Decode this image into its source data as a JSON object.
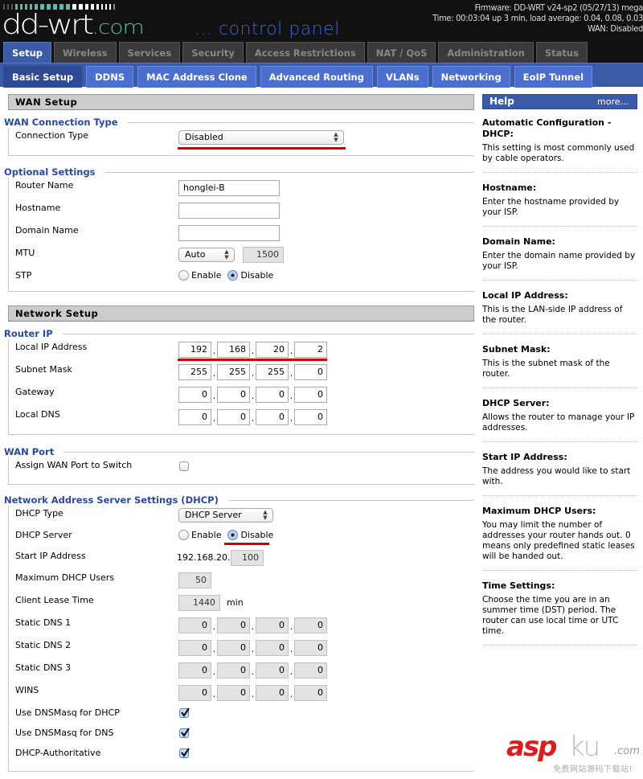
{
  "header": {
    "logo_main": "dd-wrt",
    "logo_suffix": ".com",
    "tagline": "... control panel",
    "firmware": "Firmware: DD-WRT v24-sp2 (05/27/13) mega",
    "time": "Time: 00:03:04 up 3 min, load average: 0.04, 0.08, 0.03",
    "wan_status": "WAN: Disabled",
    "colors": {
      "accent": "#3b5ba6",
      "logo_teal": "#5fb8a8",
      "tagline_blue": "#3a66d6"
    }
  },
  "main_tabs": [
    {
      "label": "Setup",
      "active": true
    },
    {
      "label": "Wireless",
      "active": false
    },
    {
      "label": "Services",
      "active": false
    },
    {
      "label": "Security",
      "active": false
    },
    {
      "label": "Access Restrictions",
      "active": false
    },
    {
      "label": "NAT / QoS",
      "active": false
    },
    {
      "label": "Administration",
      "active": false
    },
    {
      "label": "Status",
      "active": false
    }
  ],
  "sub_tabs": [
    {
      "label": "Basic Setup",
      "active": true
    },
    {
      "label": "DDNS",
      "active": false
    },
    {
      "label": "MAC Address Clone",
      "active": false
    },
    {
      "label": "Advanced Routing",
      "active": false
    },
    {
      "label": "VLANs",
      "active": false
    },
    {
      "label": "Networking",
      "active": false
    },
    {
      "label": "EoIP Tunnel",
      "active": false
    }
  ],
  "wan_setup": {
    "title": "WAN Setup",
    "connection": {
      "legend": "WAN Connection Type",
      "label": "Connection Type",
      "value": "Disabled"
    },
    "optional": {
      "legend": "Optional Settings",
      "router_name": {
        "label": "Router Name",
        "value": "honglei-B"
      },
      "hostname": {
        "label": "Hostname",
        "value": ""
      },
      "domain_name": {
        "label": "Domain Name",
        "value": ""
      },
      "mtu": {
        "label": "MTU",
        "mode": "Auto",
        "value": "1500"
      },
      "stp": {
        "label": "STP",
        "enable": "Enable",
        "disable": "Disable",
        "selected": "Disable"
      }
    }
  },
  "network_setup": {
    "title": "Network Setup",
    "router_ip": {
      "legend": "Router IP",
      "local_ip": {
        "label": "Local IP Address",
        "octets": [
          "192",
          "168",
          "20",
          "2"
        ]
      },
      "subnet": {
        "label": "Subnet Mask",
        "octets": [
          "255",
          "255",
          "255",
          "0"
        ]
      },
      "gateway": {
        "label": "Gateway",
        "octets": [
          "0",
          "0",
          "0",
          "0"
        ]
      },
      "local_dns": {
        "label": "Local DNS",
        "octets": [
          "0",
          "0",
          "0",
          "0"
        ]
      }
    },
    "wan_port": {
      "legend": "WAN Port",
      "assign": {
        "label": "Assign WAN Port to Switch",
        "checked": false
      }
    },
    "dhcp": {
      "legend": "Network Address Server Settings (DHCP)",
      "type": {
        "label": "DHCP Type",
        "value": "DHCP Server"
      },
      "server": {
        "label": "DHCP Server",
        "enable": "Enable",
        "disable": "Disable",
        "selected": "Disable"
      },
      "start_ip": {
        "label": "Start IP Address",
        "prefix": "192.168.20.",
        "value": "100"
      },
      "max_users": {
        "label": "Maximum DHCP Users",
        "value": "50"
      },
      "lease": {
        "label": "Client Lease Time",
        "value": "1440",
        "unit": "min"
      },
      "dns1": {
        "label": "Static DNS 1",
        "octets": [
          "0",
          "0",
          "0",
          "0"
        ]
      },
      "dns2": {
        "label": "Static DNS 2",
        "octets": [
          "0",
          "0",
          "0",
          "0"
        ]
      },
      "dns3": {
        "label": "Static DNS 3",
        "octets": [
          "0",
          "0",
          "0",
          "0"
        ]
      },
      "wins": {
        "label": "WINS",
        "octets": [
          "0",
          "0",
          "0",
          "0"
        ]
      },
      "dnsmasq_dhcp": {
        "label": "Use DNSMasq for DHCP",
        "checked": true
      },
      "dnsmasq_dns": {
        "label": "Use DNSMasq for DNS",
        "checked": true
      },
      "authoritative": {
        "label": "DHCP-Authoritative",
        "checked": true
      }
    }
  },
  "help": {
    "title": "Help",
    "more": "more...",
    "items": [
      {
        "title": "Automatic Configuration - DHCP:",
        "text": "This setting is most commonly used by cable operators."
      },
      {
        "title": "Hostname:",
        "text": "Enter the hostname provided by your ISP."
      },
      {
        "title": "Domain Name:",
        "text": "Enter the domain name provided by your ISP."
      },
      {
        "title": "Local IP Address:",
        "text": "This is the LAN-side IP address of the router."
      },
      {
        "title": "Subnet Mask:",
        "text": "This is the subnet mask of the router."
      },
      {
        "title": "DHCP Server:",
        "text": "Allows the router to manage your IP addresses."
      },
      {
        "title": "Start IP Address:",
        "text": "The address you would like to start with."
      },
      {
        "title": "Maximum DHCP Users:",
        "text": "You may limit the number of addresses your router hands out. 0 means only predefined static leases will be handed out."
      },
      {
        "title": "Time Settings:",
        "text": "Choose the time you are in an summer time (DST) period. The router can use local time or UTC time."
      }
    ]
  },
  "watermark": {
    "brand_red": "asp",
    "brand_gray": "ku",
    "suffix": ".com",
    "subtitle": "免费网站源码下载站!"
  }
}
